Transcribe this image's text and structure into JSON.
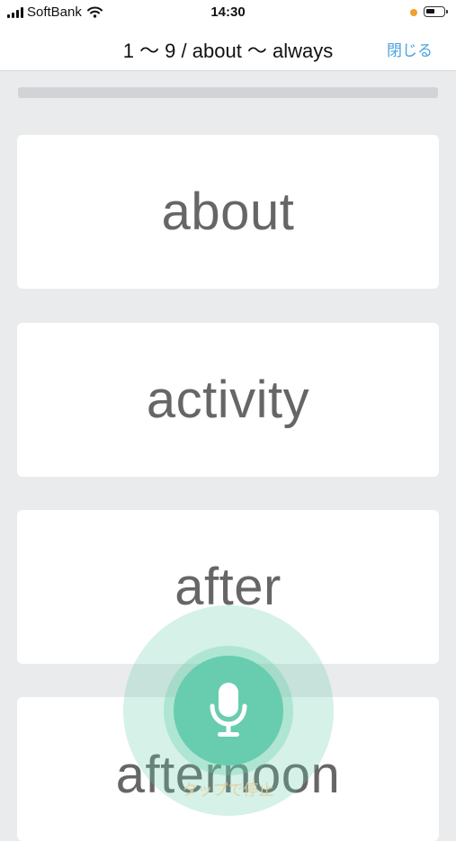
{
  "status_bar": {
    "carrier": "SoftBank",
    "time": "14:30"
  },
  "header": {
    "title": "1 〜 9 / about 〜 always",
    "close_label": "閉じる"
  },
  "progress": {
    "fraction": 0
  },
  "cards": [
    {
      "word": "about",
      "active": true
    },
    {
      "word": "activity",
      "active": false
    },
    {
      "word": "after",
      "active": false
    },
    {
      "word": "afternoon",
      "active": false
    }
  ],
  "mic": {
    "caption": "タップで停止"
  },
  "colors": {
    "background": "#eaebed",
    "active_card": "#e7cd98",
    "mic": "#67cdae",
    "link": "#4aa3e0"
  }
}
